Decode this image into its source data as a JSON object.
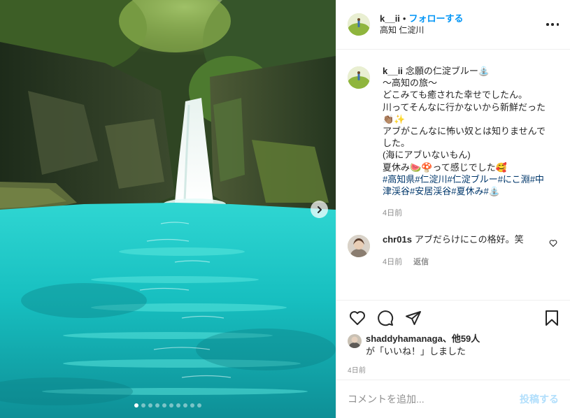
{
  "header": {
    "username": "k__ii",
    "separator": "•",
    "follow_label": "フォローする",
    "location": "高知 仁淀川"
  },
  "caption": {
    "username": "k__ii",
    "lines": [
      "念願の仁淀ブルー⛲",
      "〜高知の旅〜",
      "どこみても癒された幸せでしたん。",
      "川ってそんなに行かないから新鮮だった👏🏽✨",
      "アブがこんなに怖い奴とは知りませんでした。",
      "(海にアブいないもん)",
      "夏休み🍉🍄って感じでした🥰"
    ],
    "hashtags": [
      "#高知県",
      "#仁淀川",
      "#仁淀ブルー",
      "#にこ淵",
      "#中津渓谷",
      "#安居渓谷",
      "#夏休み",
      "#⛲"
    ],
    "time": "4日前"
  },
  "comment": {
    "username": "chr01s",
    "text": "アブだらけにこの格好。笑",
    "time": "4日前",
    "reply_label": "返信"
  },
  "likes": {
    "user": "shaddyhamanaga",
    "others": "、他59人",
    "suffix": "が「いいね！」しました",
    "date": "4日前"
  },
  "add_comment": {
    "placeholder": "コメントを追加...",
    "post_label": "投稿する"
  },
  "carousel": {
    "slide_count": 10,
    "active_index": 0
  },
  "icons": {
    "more": "more-options-icon",
    "like": "heart-icon",
    "comment": "comment-bubble-icon",
    "share": "paper-plane-icon",
    "save": "bookmark-icon",
    "next": "chevron-right-icon"
  },
  "colors": {
    "link": "#0095f6",
    "hashtag": "#00376b",
    "muted": "#8e8e8e",
    "water": "#19c7c4"
  }
}
